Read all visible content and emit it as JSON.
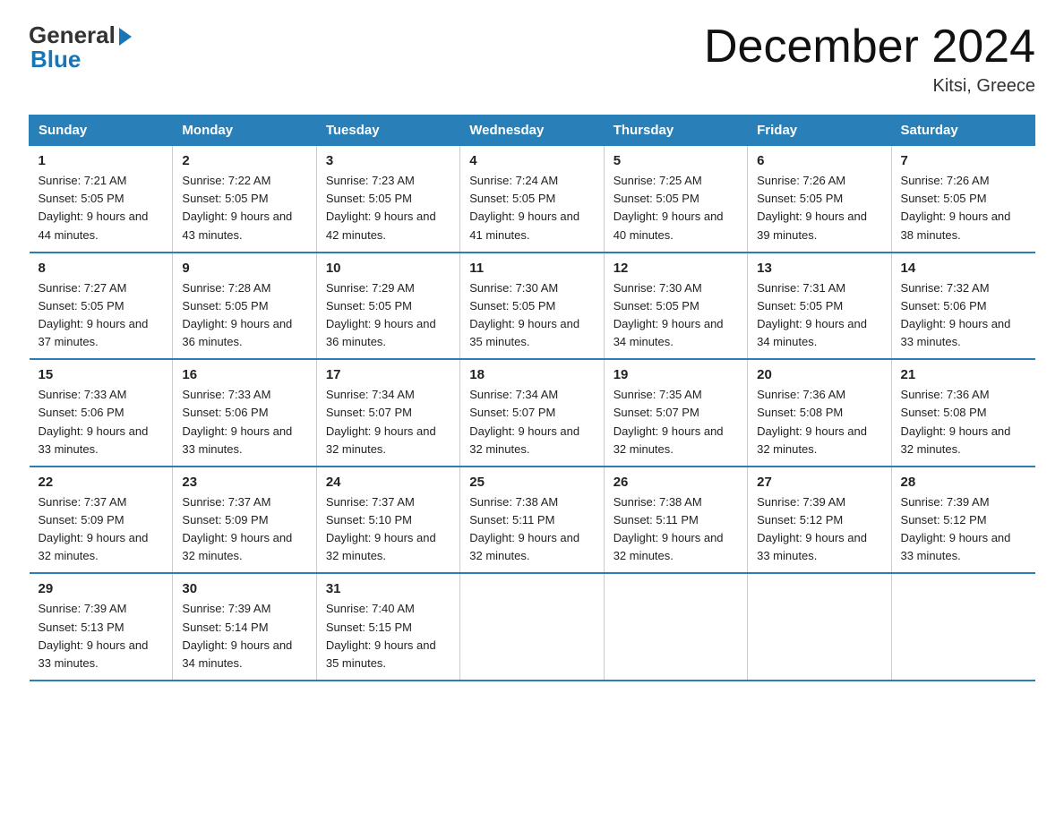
{
  "logo": {
    "general": "General",
    "blue": "Blue"
  },
  "header": {
    "title": "December 2024",
    "location": "Kitsi, Greece"
  },
  "weekdays": [
    "Sunday",
    "Monday",
    "Tuesday",
    "Wednesday",
    "Thursday",
    "Friday",
    "Saturday"
  ],
  "weeks": [
    [
      {
        "day": "1",
        "sunrise": "Sunrise: 7:21 AM",
        "sunset": "Sunset: 5:05 PM",
        "daylight": "Daylight: 9 hours and 44 minutes."
      },
      {
        "day": "2",
        "sunrise": "Sunrise: 7:22 AM",
        "sunset": "Sunset: 5:05 PM",
        "daylight": "Daylight: 9 hours and 43 minutes."
      },
      {
        "day": "3",
        "sunrise": "Sunrise: 7:23 AM",
        "sunset": "Sunset: 5:05 PM",
        "daylight": "Daylight: 9 hours and 42 minutes."
      },
      {
        "day": "4",
        "sunrise": "Sunrise: 7:24 AM",
        "sunset": "Sunset: 5:05 PM",
        "daylight": "Daylight: 9 hours and 41 minutes."
      },
      {
        "day": "5",
        "sunrise": "Sunrise: 7:25 AM",
        "sunset": "Sunset: 5:05 PM",
        "daylight": "Daylight: 9 hours and 40 minutes."
      },
      {
        "day": "6",
        "sunrise": "Sunrise: 7:26 AM",
        "sunset": "Sunset: 5:05 PM",
        "daylight": "Daylight: 9 hours and 39 minutes."
      },
      {
        "day": "7",
        "sunrise": "Sunrise: 7:26 AM",
        "sunset": "Sunset: 5:05 PM",
        "daylight": "Daylight: 9 hours and 38 minutes."
      }
    ],
    [
      {
        "day": "8",
        "sunrise": "Sunrise: 7:27 AM",
        "sunset": "Sunset: 5:05 PM",
        "daylight": "Daylight: 9 hours and 37 minutes."
      },
      {
        "day": "9",
        "sunrise": "Sunrise: 7:28 AM",
        "sunset": "Sunset: 5:05 PM",
        "daylight": "Daylight: 9 hours and 36 minutes."
      },
      {
        "day": "10",
        "sunrise": "Sunrise: 7:29 AM",
        "sunset": "Sunset: 5:05 PM",
        "daylight": "Daylight: 9 hours and 36 minutes."
      },
      {
        "day": "11",
        "sunrise": "Sunrise: 7:30 AM",
        "sunset": "Sunset: 5:05 PM",
        "daylight": "Daylight: 9 hours and 35 minutes."
      },
      {
        "day": "12",
        "sunrise": "Sunrise: 7:30 AM",
        "sunset": "Sunset: 5:05 PM",
        "daylight": "Daylight: 9 hours and 34 minutes."
      },
      {
        "day": "13",
        "sunrise": "Sunrise: 7:31 AM",
        "sunset": "Sunset: 5:05 PM",
        "daylight": "Daylight: 9 hours and 34 minutes."
      },
      {
        "day": "14",
        "sunrise": "Sunrise: 7:32 AM",
        "sunset": "Sunset: 5:06 PM",
        "daylight": "Daylight: 9 hours and 33 minutes."
      }
    ],
    [
      {
        "day": "15",
        "sunrise": "Sunrise: 7:33 AM",
        "sunset": "Sunset: 5:06 PM",
        "daylight": "Daylight: 9 hours and 33 minutes."
      },
      {
        "day": "16",
        "sunrise": "Sunrise: 7:33 AM",
        "sunset": "Sunset: 5:06 PM",
        "daylight": "Daylight: 9 hours and 33 minutes."
      },
      {
        "day": "17",
        "sunrise": "Sunrise: 7:34 AM",
        "sunset": "Sunset: 5:07 PM",
        "daylight": "Daylight: 9 hours and 32 minutes."
      },
      {
        "day": "18",
        "sunrise": "Sunrise: 7:34 AM",
        "sunset": "Sunset: 5:07 PM",
        "daylight": "Daylight: 9 hours and 32 minutes."
      },
      {
        "day": "19",
        "sunrise": "Sunrise: 7:35 AM",
        "sunset": "Sunset: 5:07 PM",
        "daylight": "Daylight: 9 hours and 32 minutes."
      },
      {
        "day": "20",
        "sunrise": "Sunrise: 7:36 AM",
        "sunset": "Sunset: 5:08 PM",
        "daylight": "Daylight: 9 hours and 32 minutes."
      },
      {
        "day": "21",
        "sunrise": "Sunrise: 7:36 AM",
        "sunset": "Sunset: 5:08 PM",
        "daylight": "Daylight: 9 hours and 32 minutes."
      }
    ],
    [
      {
        "day": "22",
        "sunrise": "Sunrise: 7:37 AM",
        "sunset": "Sunset: 5:09 PM",
        "daylight": "Daylight: 9 hours and 32 minutes."
      },
      {
        "day": "23",
        "sunrise": "Sunrise: 7:37 AM",
        "sunset": "Sunset: 5:09 PM",
        "daylight": "Daylight: 9 hours and 32 minutes."
      },
      {
        "day": "24",
        "sunrise": "Sunrise: 7:37 AM",
        "sunset": "Sunset: 5:10 PM",
        "daylight": "Daylight: 9 hours and 32 minutes."
      },
      {
        "day": "25",
        "sunrise": "Sunrise: 7:38 AM",
        "sunset": "Sunset: 5:11 PM",
        "daylight": "Daylight: 9 hours and 32 minutes."
      },
      {
        "day": "26",
        "sunrise": "Sunrise: 7:38 AM",
        "sunset": "Sunset: 5:11 PM",
        "daylight": "Daylight: 9 hours and 32 minutes."
      },
      {
        "day": "27",
        "sunrise": "Sunrise: 7:39 AM",
        "sunset": "Sunset: 5:12 PM",
        "daylight": "Daylight: 9 hours and 33 minutes."
      },
      {
        "day": "28",
        "sunrise": "Sunrise: 7:39 AM",
        "sunset": "Sunset: 5:12 PM",
        "daylight": "Daylight: 9 hours and 33 minutes."
      }
    ],
    [
      {
        "day": "29",
        "sunrise": "Sunrise: 7:39 AM",
        "sunset": "Sunset: 5:13 PM",
        "daylight": "Daylight: 9 hours and 33 minutes."
      },
      {
        "day": "30",
        "sunrise": "Sunrise: 7:39 AM",
        "sunset": "Sunset: 5:14 PM",
        "daylight": "Daylight: 9 hours and 34 minutes."
      },
      {
        "day": "31",
        "sunrise": "Sunrise: 7:40 AM",
        "sunset": "Sunset: 5:15 PM",
        "daylight": "Daylight: 9 hours and 35 minutes."
      },
      null,
      null,
      null,
      null
    ]
  ]
}
